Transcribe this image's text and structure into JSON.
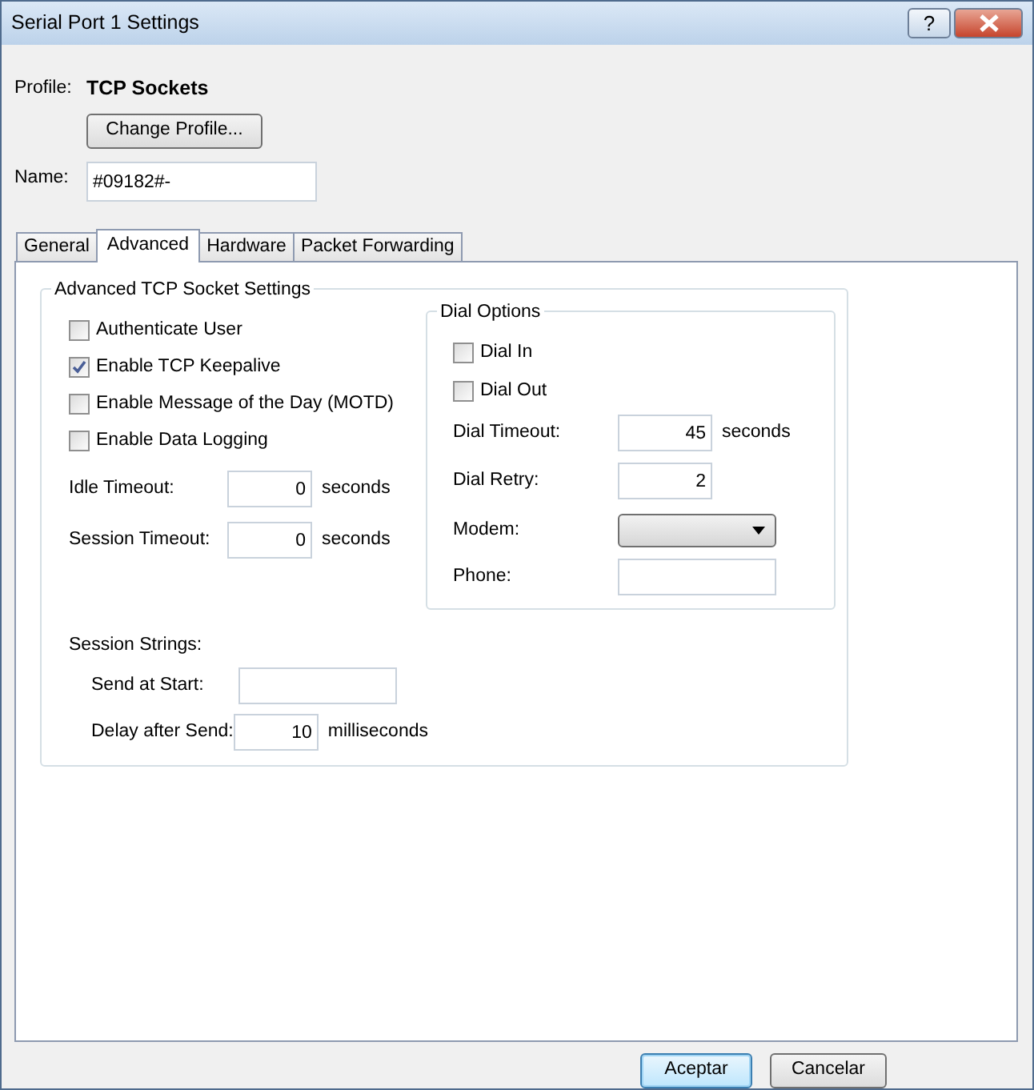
{
  "window": {
    "title": "Serial Port 1 Settings",
    "help_button": "?"
  },
  "profile": {
    "label": "Profile:",
    "value": "TCP Sockets",
    "button": "Change Profile..."
  },
  "name": {
    "label": "Name:",
    "value": "#09182#-"
  },
  "tabs": [
    {
      "label": "General",
      "selected": false
    },
    {
      "label": "Advanced",
      "selected": true
    },
    {
      "label": "Hardware",
      "selected": false
    },
    {
      "label": "Packet Forwarding",
      "selected": false
    }
  ],
  "advanced_group": {
    "title": "Advanced TCP Socket Settings",
    "items": [
      {
        "kind": "checkbox",
        "label": "Authenticate User",
        "checked": false
      },
      {
        "kind": "checkbox",
        "label": "Enable TCP Keepalive",
        "checked": true
      },
      {
        "kind": "checkbox",
        "label": "Enable Message of the Day (MOTD)",
        "checked": false
      },
      {
        "kind": "checkbox",
        "label": "Enable Data Logging",
        "checked": false
      },
      {
        "kind": "number",
        "label": "Idle Timeout:",
        "value": "0",
        "unit": "seconds"
      },
      {
        "kind": "number",
        "label": "Session Timeout:",
        "value": "0",
        "unit": "seconds"
      }
    ],
    "session_strings": {
      "label": "Session Strings:",
      "items": [
        {
          "kind": "text",
          "label": "Send at Start:"
        },
        {
          "kind": "number",
          "label": "Delay after Send:",
          "value": "10",
          "unit": "milliseconds"
        }
      ]
    }
  },
  "dial_group": {
    "title": "Dial Options",
    "items": [
      {
        "kind": "checkbox",
        "label": "Dial In",
        "checked": false
      },
      {
        "kind": "checkbox",
        "label": "Dial Out",
        "checked": false
      },
      {
        "kind": "number",
        "label": "Dial Timeout:",
        "value": "45",
        "unit": "seconds"
      },
      {
        "kind": "number",
        "label": "Dial Retry:",
        "value": "2"
      },
      {
        "kind": "select",
        "label": "Modem:"
      },
      {
        "kind": "text",
        "label": "Phone:"
      }
    ]
  },
  "buttons": [
    {
      "label": "Aceptar",
      "default": true
    },
    {
      "label": "Cancelar",
      "default": false
    }
  ]
}
